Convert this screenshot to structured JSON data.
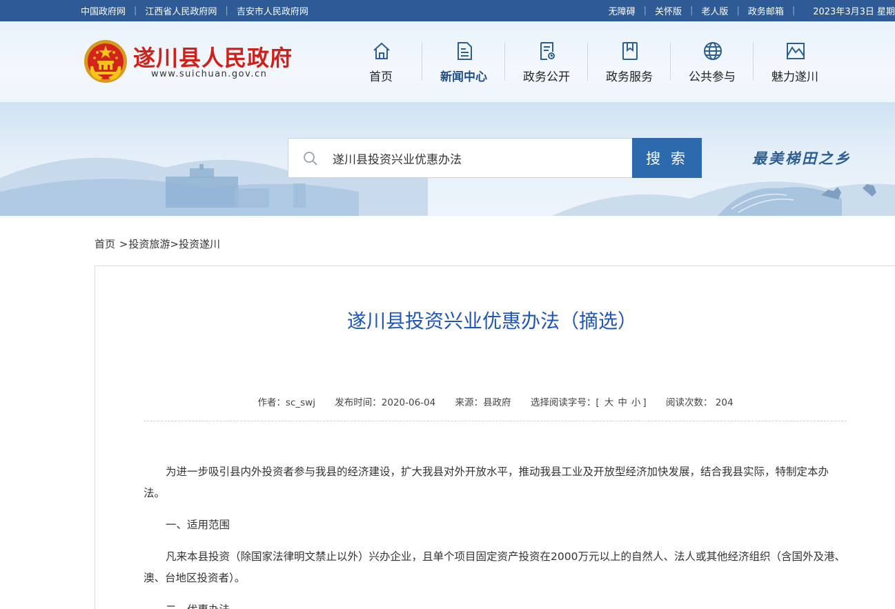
{
  "topbar": {
    "links": [
      "中国政府网",
      "江西省人民政府网",
      "吉安市人民政府网"
    ],
    "right_links": [
      "无障碍",
      "关怀版",
      "老人版",
      "政务邮箱"
    ],
    "date": "2023年3月3日 星期"
  },
  "header": {
    "site_title": "遂川县人民政府",
    "site_url": "www.suichuan.gov.cn",
    "nav": [
      {
        "label": "首页",
        "icon": "home-icon"
      },
      {
        "label": "新闻中心",
        "icon": "news-document-icon",
        "active": true
      },
      {
        "label": "政务公开",
        "icon": "public-affairs-icon"
      },
      {
        "label": "政务服务",
        "icon": "bookmark-service-icon"
      },
      {
        "label": "公共参与",
        "icon": "globe-icon"
      },
      {
        "label": "魅力遂川",
        "icon": "landscape-icon"
      }
    ]
  },
  "banner": {
    "search_value": "遂川县投资兴业优惠办法",
    "search_button": "搜 索",
    "slogan": "最美梯田之乡"
  },
  "breadcrumb": {
    "home": "首页",
    "sep1": " >",
    "level1": "投资旅游",
    "sep2": ">",
    "level2": "投资遂川"
  },
  "article": {
    "title": "遂川县投资兴业优惠办法（摘选）",
    "meta": {
      "author": "作者：sc_swj",
      "publish_time": "发布时间：2020-06-04",
      "source": "来源：县政府",
      "font_size_label": "选择阅读字号：[",
      "font_large": "大",
      "font_medium": "中",
      "font_small": "小",
      "font_size_end": "]",
      "read_count_label": "阅读次数：",
      "read_count": "204"
    },
    "paragraphs": [
      "为进一步吸引县内外投资者参与我县的经济建设，扩大我县对外开放水平，推动我县工业及开放型经济加快发展，结合我县实际，特制定本办法。",
      "一、适用范围",
      "凡来本县投资（除国家法律明文禁止以外）兴办企业，且单个项目固定资产投资在2000万元以上的自然人、法人或其他经济组织（含国外及港、澳、台地区投资者）。",
      "二、优惠办法"
    ]
  },
  "colors": {
    "topbar_bg": "#2e5b95",
    "title_blue": "#1f56b8",
    "logo_red": "#d0201a",
    "search_btn": "#2c6aad"
  }
}
